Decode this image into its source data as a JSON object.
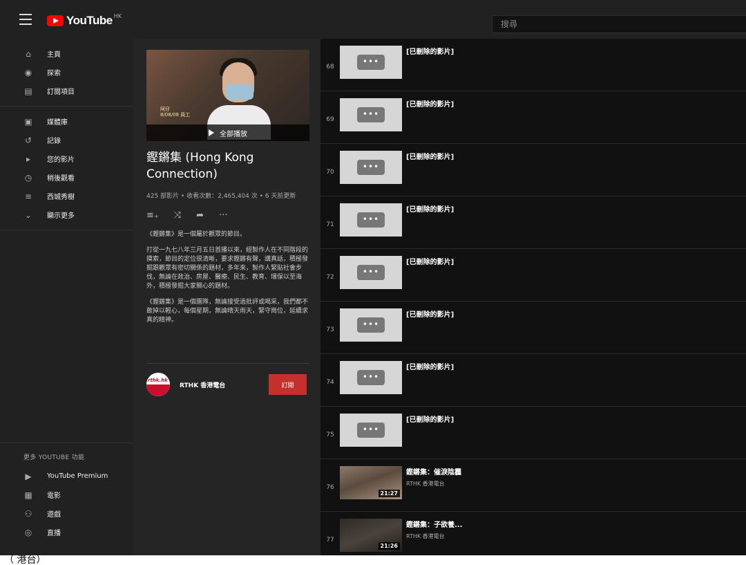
{
  "header": {
    "logo_text": "YouTube",
    "region": "HK",
    "search_placeholder": "搜尋"
  },
  "sidebar": {
    "primary": [
      {
        "label": "主頁",
        "icon": "home-icon"
      },
      {
        "label": "探索",
        "icon": "explore-icon"
      },
      {
        "label": "訂閱項目",
        "icon": "subscriptions-icon"
      }
    ],
    "library": [
      {
        "label": "媒體庫",
        "icon": "library-icon"
      },
      {
        "label": "記錄",
        "icon": "history-icon"
      },
      {
        "label": "您的影片",
        "icon": "your-videos-icon"
      },
      {
        "label": "稍後觀看",
        "icon": "watch-later-icon"
      },
      {
        "label": "西城秀樹",
        "icon": "playlist-icon"
      },
      {
        "label": "顯示更多",
        "icon": "chevron-down-icon"
      }
    ],
    "more_title": "更多 YOUTUBE 功能",
    "more": [
      {
        "label": "YouTube Premium",
        "icon": "premium-icon"
      },
      {
        "label": "電影",
        "icon": "movies-icon"
      },
      {
        "label": "遊戲",
        "icon": "gaming-icon"
      },
      {
        "label": "直播",
        "icon": "live-icon"
      }
    ]
  },
  "playlist": {
    "play_all": "全部播放",
    "hero_caption_line1": "阿仔",
    "hero_caption_line2": "8/08/08 員工",
    "title": "鏗鏘集 (Hong Kong Connection)",
    "stats": "425 部影片 • 收看次數：2,465,404 次 • 6 天前更新",
    "description": [
      "《鏗鏘集》是一個屬於觀眾的節目。",
      "打從一九七八年三月五日首播以來，經製作人在不同階段的摸索，節目的定位很清晰，要求鏗鏘有聲，講真話，積極發掘跟觀眾有密切關係的題材，多年來，製作人緊貼社會步伐，無論在政治、房屋、醫療、民生、教育、環保以至海外，積極發掘大家關心的題材。",
      "《鏗鏘集》是一個團隊，無論接受過批評或喝采，我們都不敢掉以輕心，每個星期，無論晴天雨天，緊守崗位，延續求真的精神。"
    ],
    "channel_name": "RTHK 香港電台",
    "channel_avatar_text": "rthk.hk",
    "subscribe_label": "訂閱"
  },
  "videos": [
    {
      "index": "68",
      "title": "[已刪除的影片]",
      "channel": "",
      "duration": "",
      "deleted": true
    },
    {
      "index": "69",
      "title": "[已刪除的影片]",
      "channel": "",
      "duration": "",
      "deleted": true
    },
    {
      "index": "70",
      "title": "[已刪除的影片]",
      "channel": "",
      "duration": "",
      "deleted": true
    },
    {
      "index": "71",
      "title": "[已刪除的影片]",
      "channel": "",
      "duration": "",
      "deleted": true
    },
    {
      "index": "72",
      "title": "[已刪除的影片]",
      "channel": "",
      "duration": "",
      "deleted": true
    },
    {
      "index": "73",
      "title": "[已刪除的影片]",
      "channel": "",
      "duration": "",
      "deleted": true
    },
    {
      "index": "74",
      "title": "[已刪除的影片]",
      "channel": "",
      "duration": "",
      "deleted": true
    },
    {
      "index": "75",
      "title": "[已刪除的影片]",
      "channel": "",
      "duration": "",
      "deleted": true
    },
    {
      "index": "76",
      "title": "鏗鏘集：催淚陰霾",
      "channel": "RTHK 香港電台",
      "duration": "21:27",
      "deleted": false
    },
    {
      "index": "77",
      "title": "鏗鏘集：子欲養...",
      "channel": "RTHK 香港電台",
      "duration": "21:26",
      "deleted": false
    }
  ],
  "deleted_thumb_glyph": "•••",
  "footer_fragment": "（ 港台）"
}
